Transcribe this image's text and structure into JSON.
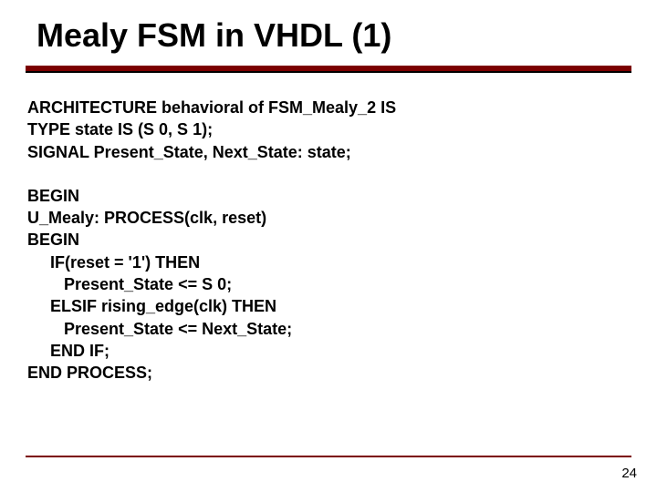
{
  "title": "Mealy FSM in VHDL (1)",
  "code": {
    "l1": "ARCHITECTURE behavioral of FSM_Mealy_2 IS",
    "l2": "TYPE state IS (S 0, S 1);",
    "l3": "SIGNAL Present_State, Next_State: state;",
    "l4": "BEGIN",
    "l5": "U_Mealy: PROCESS(clk, reset)",
    "l6": "BEGIN",
    "l7": "     IF(reset = '1') THEN",
    "l8": "        Present_State <= S 0;",
    "l9": "     ELSIF rising_edge(clk) THEN",
    "l10": "        Present_State <= Next_State;",
    "l11": "     END IF;",
    "l12": "END PROCESS;"
  },
  "page_number": "24"
}
